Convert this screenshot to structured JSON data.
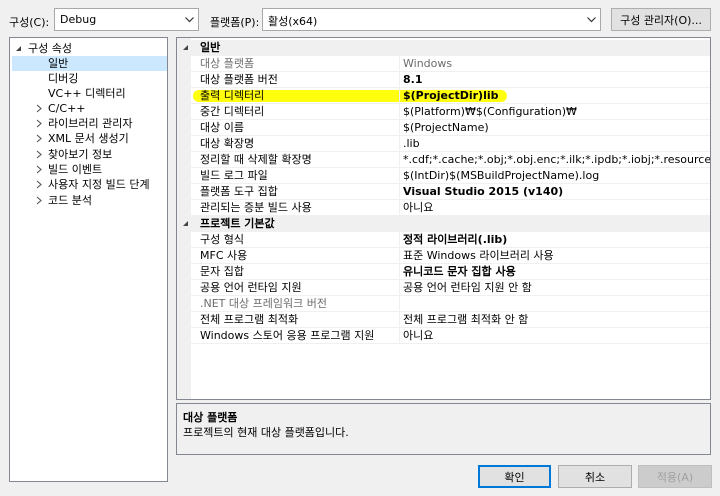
{
  "toolbar": {
    "config_label": "구성(C):",
    "config_value": "Debug",
    "platform_label": "플랫폼(P):",
    "platform_value": "활성(x64)",
    "config_manager_label": "구성 관리자(O)..."
  },
  "tree": {
    "items": [
      {
        "label": "구성 속성",
        "expander": "expanded"
      },
      {
        "label": "일반",
        "selected": true
      },
      {
        "label": "디버깅"
      },
      {
        "label": "VC++ 디렉터리"
      },
      {
        "label": "C/C++",
        "expander": "collapsed"
      },
      {
        "label": "라이브러리 관리자",
        "expander": "collapsed"
      },
      {
        "label": "XML 문서 생성기",
        "expander": "collapsed"
      },
      {
        "label": "찾아보기 정보",
        "expander": "collapsed"
      },
      {
        "label": "빌드 이벤트",
        "expander": "collapsed"
      },
      {
        "label": "사용자 지정 빌드 단계",
        "expander": "collapsed"
      },
      {
        "label": "코드 분석",
        "expander": "collapsed"
      }
    ]
  },
  "grid": {
    "general": {
      "title": "일반",
      "rows": [
        {
          "name": "대상 플랫폼",
          "value": "Windows",
          "gray": true
        },
        {
          "name": "대상 플랫폼 버전",
          "value": "8.1",
          "bold": true
        },
        {
          "name": "출력 디렉터리",
          "value": "$(ProjectDir)lib",
          "bold": true,
          "highlight": true
        },
        {
          "name": "중간 디렉터리",
          "value": "$(Platform)₩$(Configuration)₩"
        },
        {
          "name": "대상 이름",
          "value": "$(ProjectName)"
        },
        {
          "name": "대상 확장명",
          "value": ".lib"
        },
        {
          "name": "정리할 때 삭제할 확장명",
          "value": "*.cdf;*.cache;*.obj;*.obj.enc;*.ilk;*.ipdb;*.iobj;*.resources;*.tlb;*.tli;*.tlh"
        },
        {
          "name": "빌드 로그 파일",
          "value": "$(IntDir)$(MSBuildProjectName).log"
        },
        {
          "name": "플랫폼 도구 집합",
          "value": "Visual Studio 2015 (v140)",
          "bold": true
        },
        {
          "name": "관리되는 증분 빌드 사용",
          "value": "아니요"
        }
      ]
    },
    "defaults": {
      "title": "프로젝트 기본값",
      "rows": [
        {
          "name": "구성 형식",
          "value": "정적 라이브러리(.lib)",
          "bold": true
        },
        {
          "name": "MFC 사용",
          "value": "표준 Windows 라이브러리 사용"
        },
        {
          "name": "문자 집합",
          "value": "유니코드 문자 집합 사용",
          "bold": true
        },
        {
          "name": "공용 언어 런타임 지원",
          "value": "공용 언어 런타임 지원 안 함"
        },
        {
          "name": ".NET 대상 프레임워크 버전",
          "value": "",
          "gray_name": true
        },
        {
          "name": "전체 프로그램 최적화",
          "value": "전체 프로그램 최적화 안 함"
        },
        {
          "name": "Windows 스토어 응용 프로그램 지원",
          "value": "아니요"
        }
      ]
    }
  },
  "description": {
    "title": "대상 플랫폼",
    "text": "프로젝트의 현재 대상 플랫폼입니다."
  },
  "buttons": {
    "ok": "확인",
    "cancel": "취소",
    "apply": "적용(A)"
  },
  "colors": {
    "highlight": "#ffff0e",
    "selected": "#cce8ff",
    "primary_border": "#0078d7"
  }
}
